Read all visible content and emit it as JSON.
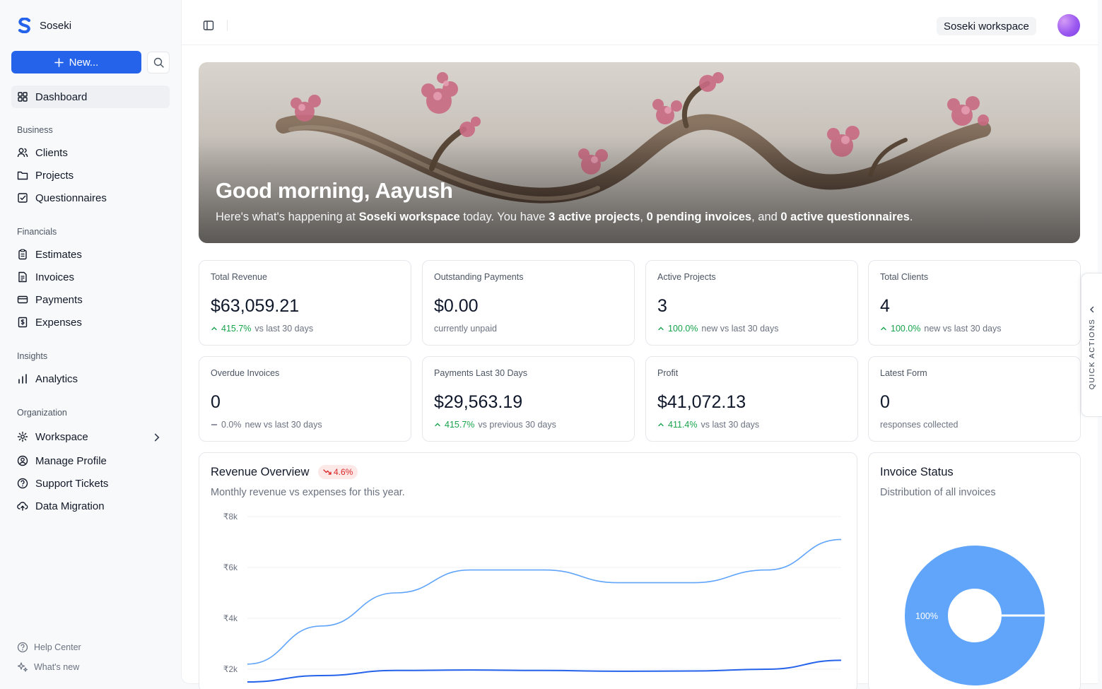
{
  "app": {
    "name": "Soseki"
  },
  "sidebar": {
    "new_button": "New...",
    "dashboard": "Dashboard",
    "sections": {
      "business": "Business",
      "financials": "Financials",
      "insights": "Insights",
      "organization": "Organization"
    },
    "items": {
      "clients": "Clients",
      "projects": "Projects",
      "questionnaires": "Questionnaires",
      "estimates": "Estimates",
      "invoices": "Invoices",
      "payments": "Payments",
      "expenses": "Expenses",
      "analytics": "Analytics",
      "workspace": "Workspace",
      "manage_profile": "Manage Profile",
      "support_tickets": "Support Tickets",
      "data_migration": "Data Migration"
    },
    "footer": {
      "help": "Help Center",
      "whats_new": "What's new"
    }
  },
  "topbar": {
    "workspace": "Soseki workspace"
  },
  "hero": {
    "greeting": "Good morning, Aayush",
    "sub_1": "Here's what's happening at ",
    "workspace": "Soseki workspace",
    "sub_2": " today. You have ",
    "projects": "3 active projects",
    "sep_1": ", ",
    "invoices": "0 pending invoices",
    "sep_2": ", and ",
    "questionnaires": "0 active questionnaires",
    "end": "."
  },
  "stats": {
    "total_revenue": {
      "label": "Total Revenue",
      "value": "$63,059.21",
      "change": "415.7%",
      "note": "vs last 30 days"
    },
    "outstanding": {
      "label": "Outstanding Payments",
      "value": "$0.00",
      "note": "currently unpaid"
    },
    "active_projects": {
      "label": "Active Projects",
      "value": "3",
      "change": "100.0%",
      "note": "new vs last 30 days"
    },
    "total_clients": {
      "label": "Total Clients",
      "value": "4",
      "change": "100.0%",
      "note": "new vs last 30 days"
    },
    "overdue": {
      "label": "Overdue Invoices",
      "value": "0",
      "change": "0.0%",
      "note": "new vs last 30 days"
    },
    "payments_30": {
      "label": "Payments Last 30 Days",
      "value": "$29,563.19",
      "change": "415.7%",
      "note": "vs previous 30 days"
    },
    "profit": {
      "label": "Profit",
      "value": "$41,072.13",
      "change": "411.4%",
      "note": "vs last 30 days"
    },
    "latest_form": {
      "label": "Latest Form",
      "value": "0",
      "note": "responses collected"
    }
  },
  "revenue": {
    "title": "Revenue Overview",
    "badge": "4.6%",
    "subtitle": "Monthly revenue vs expenses for this year."
  },
  "invoice_status": {
    "title": "Invoice Status",
    "subtitle": "Distribution of all invoices"
  },
  "quick_actions": "QUICK ACTIONS",
  "colors": {
    "accent": "#2563eb",
    "positive": "#16a34a",
    "negative": "#dc2626",
    "chart_light": "#60a5fa"
  },
  "chart_data": [
    {
      "type": "line",
      "title": "Revenue Overview",
      "ylim": [
        1500,
        8000
      ],
      "y_ticks": [
        "₹2k",
        "₹4k",
        "₹6k",
        "₹8k"
      ],
      "y_tick_values": [
        2000,
        4000,
        6000,
        8000
      ],
      "grid": true,
      "series": [
        {
          "values": [
            2200,
            3700,
            5000,
            5900,
            5900,
            5400,
            5400,
            5900,
            7100
          ]
        },
        {
          "values": [
            1500,
            1750,
            1950,
            1970,
            1950,
            1920,
            1930,
            2000,
            2350
          ]
        }
      ]
    },
    {
      "type": "pie",
      "title": "Invoice Status",
      "values": [
        100
      ],
      "labels": [
        "100%"
      ]
    }
  ]
}
